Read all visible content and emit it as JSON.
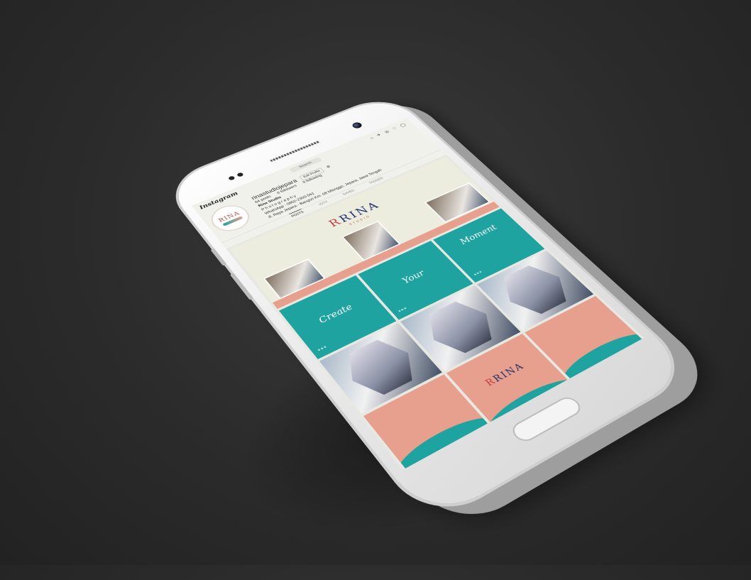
{
  "instagram": {
    "logo": "Instagram",
    "search_placeholder": "Search",
    "username": "rinastudiojepara",
    "edit_label": "Edit Profile",
    "stats": {
      "posts": "64 posts",
      "followers": "0 followers",
      "following": "0 following"
    },
    "bio": {
      "name": "Rina Studio",
      "line1": "P h o t o g r a p h y",
      "line2": "WhatsApp : 0852-2300-561",
      "line3": "Jl. Raya Jepara - Bangsri Km. 08 Mlonggo, Jepara, Jawa Tengah"
    },
    "tabs": [
      "POSTS",
      "IGTV",
      "SAVED",
      "TAGGED"
    ],
    "avatar_logo": "RINA"
  },
  "posts": {
    "brand": "RINA",
    "brand_sub": "STUDIO",
    "word1": "Create",
    "word2": "Your",
    "word3": "Moment"
  },
  "colors": {
    "teal": "#1fa3a0",
    "peach": "#e7a08d",
    "navy": "#1d2e6a",
    "red": "#c23b3b"
  }
}
